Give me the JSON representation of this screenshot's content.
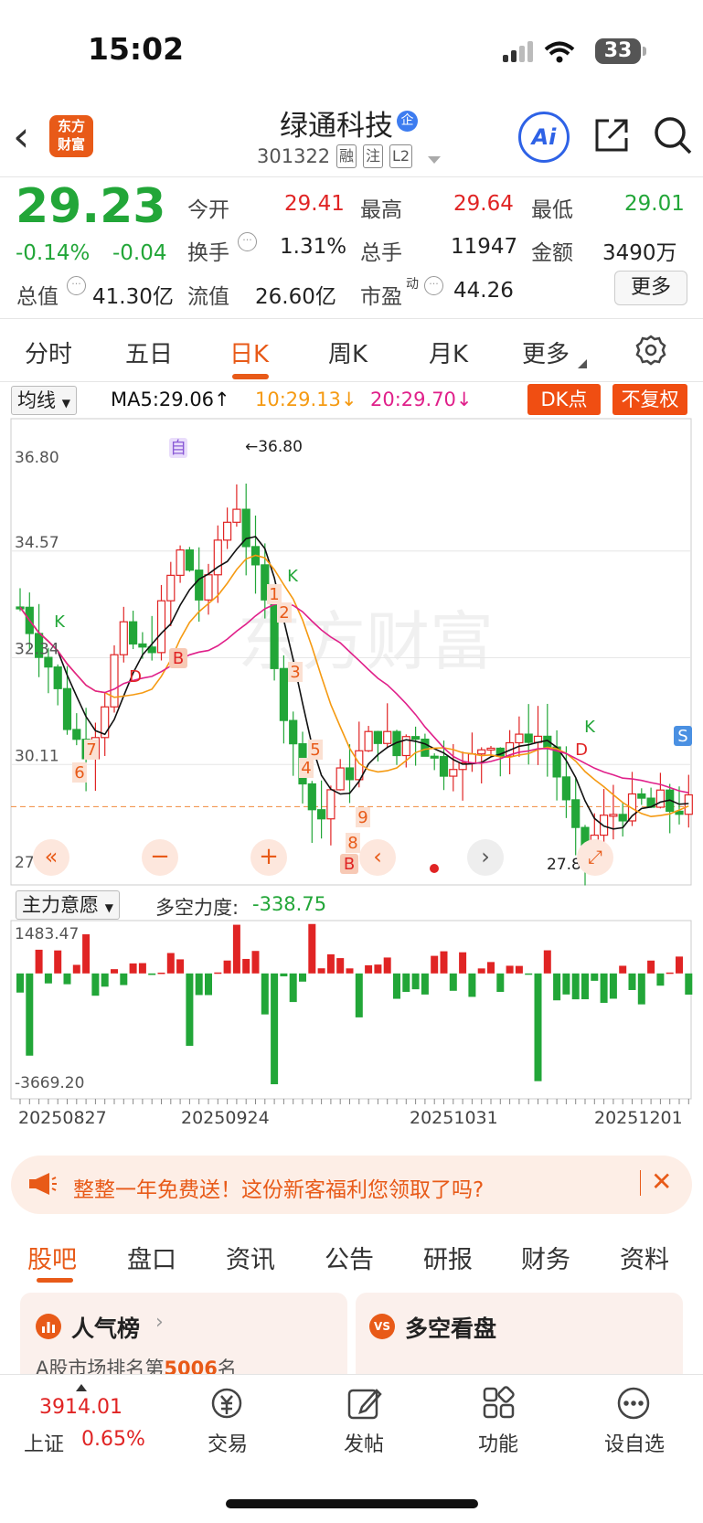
{
  "status": {
    "time": "15:02",
    "battery": "33"
  },
  "header": {
    "logo_line1": "东方",
    "logo_line2": "财富",
    "stock_name": "绿通科技",
    "name_badge": "企",
    "code": "301322",
    "tags": [
      "融",
      "注",
      "L2"
    ],
    "ai_label": "Ai"
  },
  "quote": {
    "price": "29.23",
    "change_pct": "-0.14%",
    "change_abs": "-0.04",
    "open_label": "今开",
    "open": "29.41",
    "high_label": "最高",
    "high": "29.64",
    "low_label": "最低",
    "low": "29.01",
    "turnover_label": "换手",
    "turnover": "1.31%",
    "volume_label": "总手",
    "volume": "11947",
    "amount_label": "金额",
    "amount": "3490万",
    "mktcap_label": "总值",
    "mktcap": "41.30亿",
    "float_label": "流值",
    "float_cap": "26.60亿",
    "pe_label": "市盈",
    "pe_sup": "动",
    "pe": "44.26",
    "more_label": "更多"
  },
  "tabs": [
    "分时",
    "五日",
    "日K",
    "周K",
    "月K",
    "更多"
  ],
  "active_tab": "日K",
  "ma_bar": {
    "indicator": "均线",
    "ma5": "MA5:29.06",
    "ma10": "10:29.13",
    "ma20": "20:29.70",
    "dk_button": "DK点",
    "adjust_button": "不复权"
  },
  "sub_bar": {
    "indicator": "主力意愿",
    "label": "多空力度:",
    "value": "-338.75"
  },
  "colors": {
    "up": "#e02424",
    "down": "#22a638",
    "ma5": "#111111",
    "ma10": "#f59a12",
    "ma20": "#e0208a",
    "accent": "#e85a18"
  },
  "chart_data": [
    {
      "type": "candlestick",
      "ylim": [
        27.88,
        36.8
      ],
      "y_ticks": [
        "36.80",
        "34.57",
        "32.34",
        "30.11",
        "27.88"
      ],
      "max_label": "36.80",
      "min_label": "27.88",
      "last_close": 29.23,
      "x_date_labels": [
        "20250827",
        "20250924",
        "20251031",
        "20251201"
      ],
      "overlay_marks": [
        "自",
        "B",
        "B",
        "S",
        "K",
        "K",
        "K",
        "D",
        "D",
        "1",
        "2",
        "3",
        "4",
        "5",
        "6",
        "7",
        "8",
        "9"
      ]
    },
    {
      "type": "bar",
      "title": "主力意愿",
      "ylim": [
        -3669.2,
        1483.47
      ],
      "y_ticks": [
        "1483.47",
        "-3669.20"
      ]
    }
  ],
  "ad": {
    "text": "整整一年免费送！这份新客福利您领取了吗?"
  },
  "bottom_tabs": [
    "股吧",
    "盘口",
    "资讯",
    "公告",
    "研报",
    "财务",
    "资料"
  ],
  "cards": [
    {
      "title": "人气榜",
      "sub_prefix": "A股市场排名第",
      "rank": "5006",
      "sub_suffix": "名"
    },
    {
      "title": "多空看盘"
    }
  ],
  "bottom_nav": {
    "index_value": "3914.01",
    "index_name": "上证",
    "index_change": "0.65%",
    "items": [
      "交易",
      "发帖",
      "功能",
      "设自选"
    ]
  }
}
